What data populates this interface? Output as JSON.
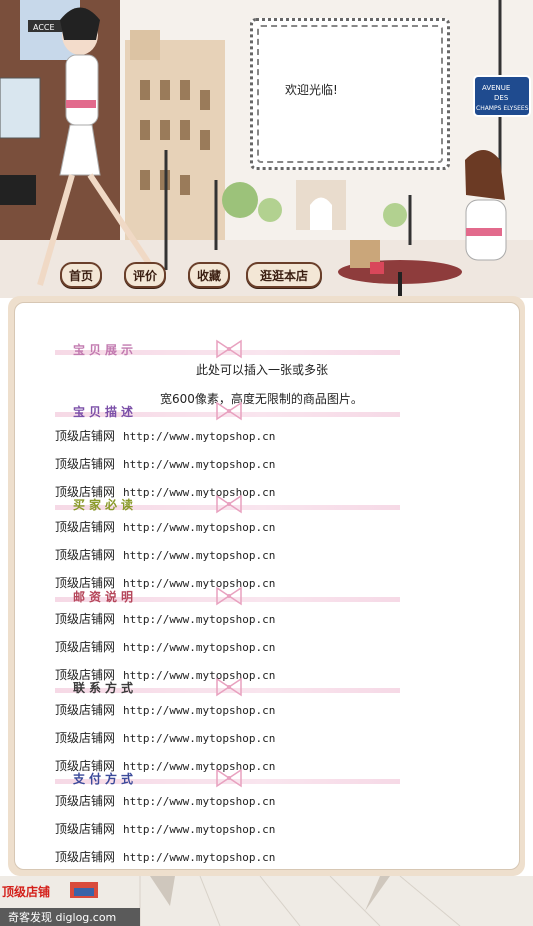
{
  "header": {
    "welcome_text": "欢迎光临!",
    "street_sign_lines": [
      "AVENUE",
      "DES",
      "CHAMPS ELYSEES"
    ],
    "shop_sign": "ACCE"
  },
  "nav": {
    "items": [
      {
        "label": "首页"
      },
      {
        "label": "评价"
      },
      {
        "label": "收藏"
      },
      {
        "label": "逛逛本店"
      }
    ]
  },
  "main": {
    "intro_line1": "此处可以插入一张或多张",
    "intro_line2": "宽600像素，高度无限制的商品图片。",
    "sections": [
      {
        "title": "宝贝展示",
        "color": "#c27ab0"
      },
      {
        "title": "宝贝描述",
        "color": "#7b4fa8"
      },
      {
        "title": "买家必读",
        "color": "#8a9a2a"
      },
      {
        "title": "邮资说明",
        "color": "#b5465a"
      },
      {
        "title": "联系方式",
        "color": "#3a3a3a"
      },
      {
        "title": "支付方式",
        "color": "#3b4a9a"
      }
    ],
    "line_label": "顶级店铺网",
    "line_url": "http://www.mytopshop.cn"
  },
  "footer": {
    "logo_text": "顶级店铺"
  },
  "watermark": {
    "text": "奇客发现 diglog.com"
  }
}
